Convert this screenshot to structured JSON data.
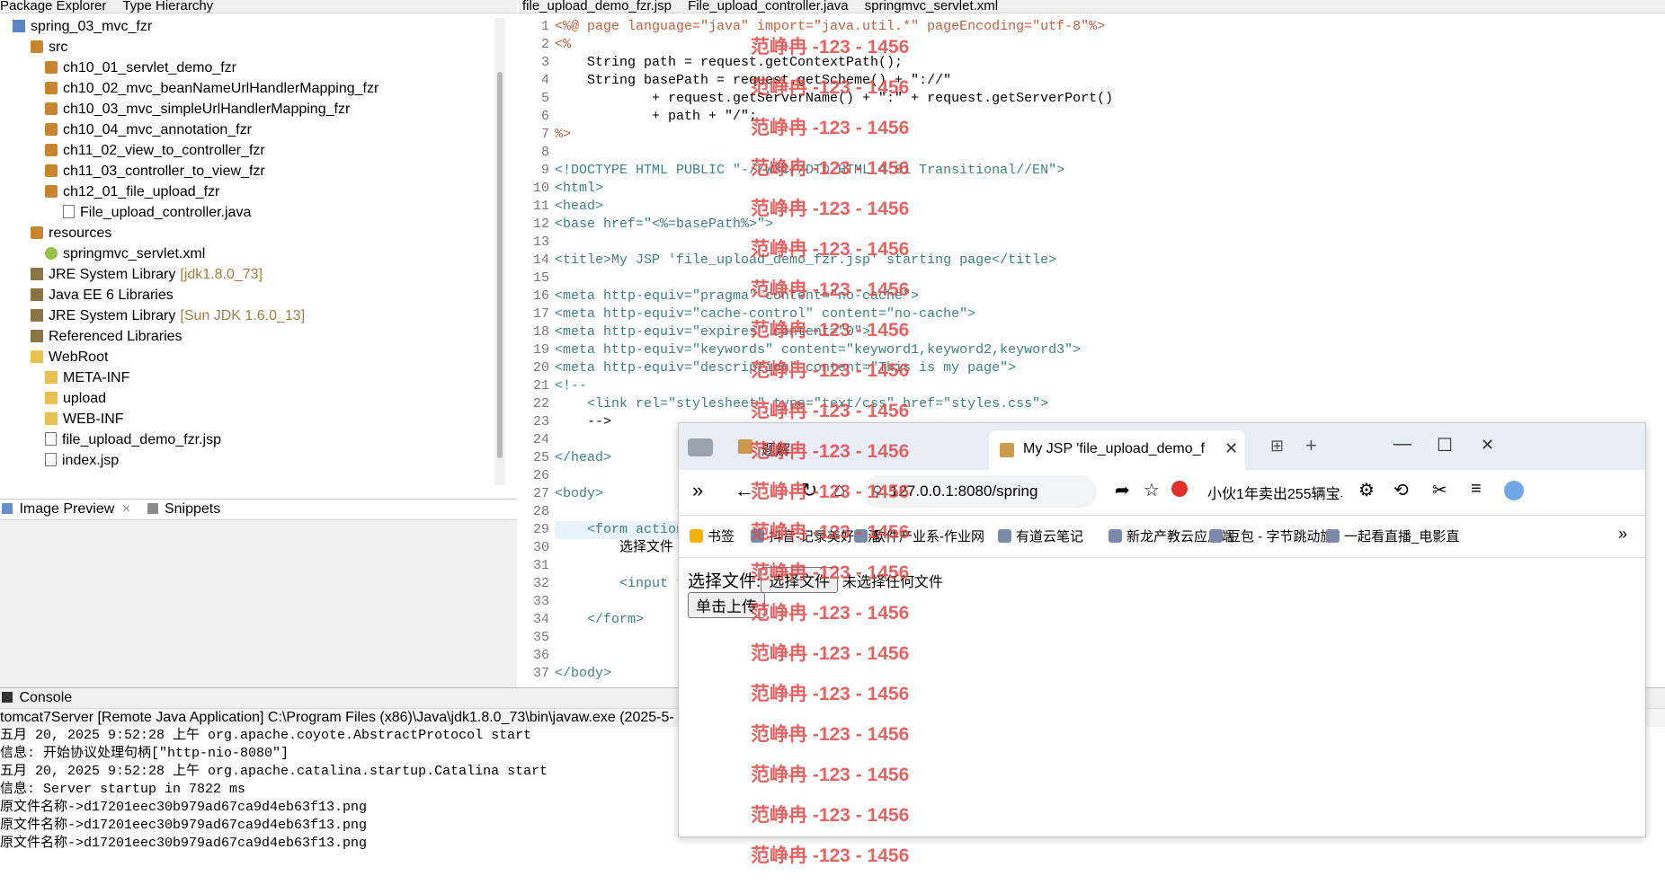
{
  "package_explorer": {
    "tabs": [
      "Package Explorer",
      "Type Hierarchy"
    ],
    "items": [
      {
        "label": "spring_03_mvc_fzr",
        "type": "proj"
      },
      {
        "label": "src",
        "type": "pkg"
      },
      {
        "label": "ch10_01_servlet_demo_fzr",
        "type": "pkg"
      },
      {
        "label": "ch10_02_mvc_beanNameUrlHandlerMapping_fzr",
        "type": "pkg"
      },
      {
        "label": "ch10_03_mvc_simpleUrlHandlerMapping_fzr",
        "type": "pkg"
      },
      {
        "label": "ch10_04_mvc_annotation_fzr",
        "type": "pkg"
      },
      {
        "label": "ch11_02_view_to_controller_fzr",
        "type": "pkg"
      },
      {
        "label": "ch11_03_controller_to_view_fzr",
        "type": "pkg"
      },
      {
        "label": "ch12_01_file_upload_fzr",
        "type": "pkg"
      },
      {
        "label": "File_upload_controller.java",
        "type": "file"
      },
      {
        "label": "resources",
        "type": "pkg"
      },
      {
        "label": "springmvc_servlet.xml",
        "type": "xml"
      },
      {
        "label": "JRE System Library",
        "extra": "[jdk1.8.0_73]",
        "type": "lib"
      },
      {
        "label": "Java EE 6 Libraries",
        "type": "lib"
      },
      {
        "label": "JRE System Library",
        "extra": "[Sun JDK 1.6.0_13]",
        "type": "lib"
      },
      {
        "label": "Referenced Libraries",
        "type": "lib"
      },
      {
        "label": "WebRoot",
        "type": "folder"
      },
      {
        "label": "META-INF",
        "type": "folder"
      },
      {
        "label": "upload",
        "type": "folder"
      },
      {
        "label": "WEB-INF",
        "type": "folder"
      },
      {
        "label": "file_upload_demo_fzr.jsp",
        "type": "file"
      },
      {
        "label": "index.jsp",
        "type": "file"
      }
    ]
  },
  "bottom_left": {
    "tabs": [
      "Image Preview",
      "Snippets"
    ]
  },
  "editor": {
    "tabs": [
      "file_upload_demo_fzr.jsp",
      "File_upload_controller.java",
      "springmvc_servlet.xml"
    ],
    "line_numbers": [
      "1",
      "2",
      "3",
      "4",
      "5",
      "6",
      "7",
      "8",
      "9",
      "10",
      "11",
      "12",
      "13",
      "14",
      "15",
      "16",
      "17",
      "18",
      "19",
      "20",
      "21",
      "22",
      "23",
      "24",
      "25",
      "26",
      "27",
      "28",
      "29",
      "30",
      "31",
      "32",
      "33",
      "34",
      "35",
      "36",
      "37"
    ],
    "lines": [
      "<%@ page language=\"java\" import=\"java.util.*\" pageEncoding=\"utf-8\"%>",
      "<%",
      "    String path = request.getContextPath();",
      "    String basePath = request.getScheme() + \"://\"",
      "            + request.getServerName() + \":\" + request.getServerPort()",
      "            + path + \"/\";",
      "%>",
      "",
      "<!DOCTYPE HTML PUBLIC \"-//W3C//DTD HTML 4.01 Transitional//EN\">",
      "<html>",
      "<head>",
      "<base href=\"<%=basePath%>\">",
      "",
      "<title>My JSP 'file_upload_demo_fzr.jsp' starting page</title>",
      "",
      "<meta http-equiv=\"pragma\" content=\"no-cache\">",
      "<meta http-equiv=\"cache-control\" content=\"no-cache\">",
      "<meta http-equiv=\"expires\" content=\"0\">",
      "<meta http-equiv=\"keywords\" content=\"keyword1,keyword2,keyword3\">",
      "<meta http-equiv=\"description\" content=\"This is my page\">",
      "<!--",
      "    <link rel=\"stylesheet\" type=\"text/css\" href=\"styles.css\">",
      "    -->",
      "",
      "</head>",
      "",
      "<body>",
      "",
      "    <form action",
      "        选择文件",
      "",
      "        <input t",
      "",
      "    </form>",
      "",
      "",
      "</body>"
    ]
  },
  "console": {
    "tab": "Console",
    "header": "tomcat7Server [Remote Java Application] C:\\Program Files (x86)\\Java\\jdk1.8.0_73\\bin\\javaw.exe (2025-5-",
    "lines": [
      "五月 20, 2025 9:52:28 上午 org.apache.coyote.AbstractProtocol start",
      "信息: 开始协议处理句柄[\"http-nio-8080\"]",
      "五月 20, 2025 9:52:28 上午 org.apache.catalina.startup.Catalina start",
      "信息: Server startup in 7822 ms",
      "原文件名称->d17201eec30b979ad67ca9d4eb63f13.png",
      "原文件名称->d17201eec30b979ad67ca9d4eb63f13.png",
      "原文件名称->d17201eec30b979ad67ca9d4eb63f13.png"
    ]
  },
  "browser": {
    "tab1_label": "题解",
    "tab2_label": "My JSP 'file_upload_demo_f",
    "address": "127.0.0.1:8080/spring",
    "search_text": "小伙1年卖出255辆宝马",
    "bookmarks": [
      "书签",
      "抖音-记录美好生活",
      "软件产业系-作业网",
      "有道云笔记",
      "新龙产教云应用端",
      "豆包 - 字节跳动旗",
      "一起看直播_电影直"
    ],
    "content": {
      "label": "选择文件:",
      "choose_button": "选择文件",
      "no_file": "未选择任何文件",
      "upload_button": "单击上传"
    }
  },
  "watermark": "范峥冉 -123 - 1456"
}
